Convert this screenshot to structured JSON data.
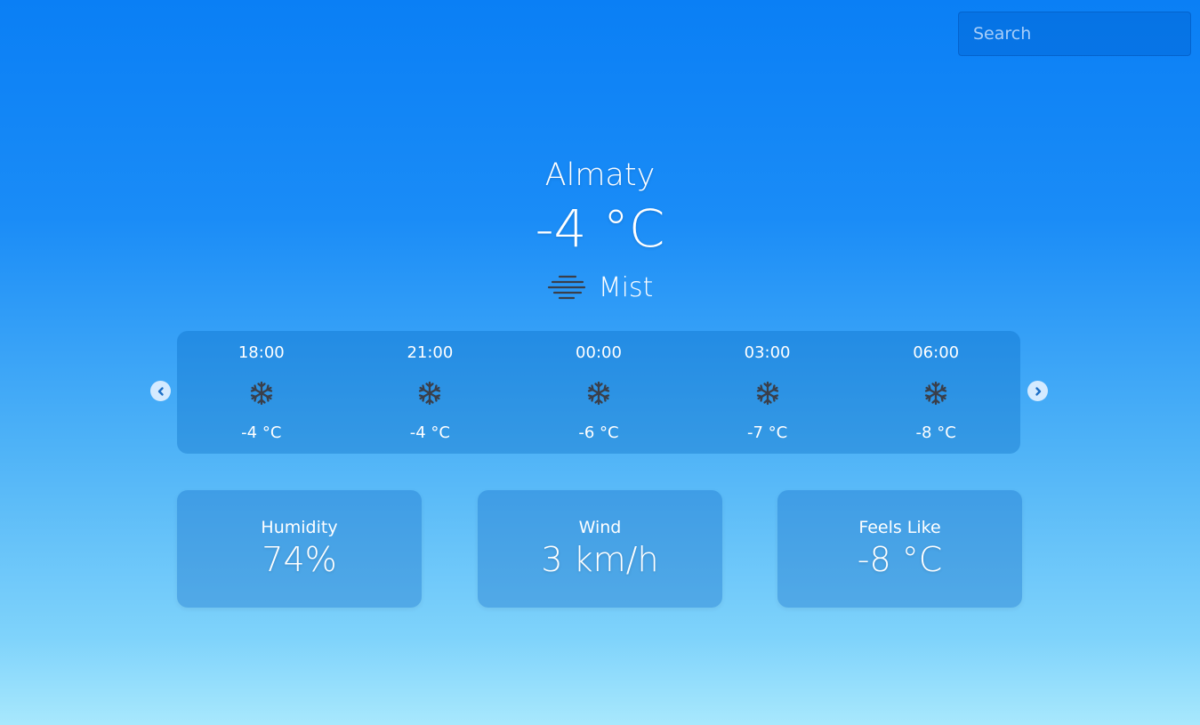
{
  "search": {
    "placeholder": "Search"
  },
  "current": {
    "city": "Almaty",
    "temperature": "-4 °C",
    "condition": "Mist",
    "condition_icon": "mist-icon"
  },
  "forecast": [
    {
      "time": "18:00",
      "icon": "snowflake-icon",
      "temp": "-4 °C"
    },
    {
      "time": "21:00",
      "icon": "snowflake-icon",
      "temp": "-4 °C"
    },
    {
      "time": "00:00",
      "icon": "snowflake-icon",
      "temp": "-6 °C"
    },
    {
      "time": "03:00",
      "icon": "snowflake-icon",
      "temp": "-7 °C"
    },
    {
      "time": "06:00",
      "icon": "snowflake-icon",
      "temp": "-8 °C"
    }
  ],
  "stats": {
    "humidity": {
      "label": "Humidity",
      "value": "74%"
    },
    "wind": {
      "label": "Wind",
      "value": "3 km/h"
    },
    "feels_like": {
      "label": "Feels Like",
      "value": "-8 °C"
    }
  },
  "colors": {
    "background_top": "#0a7ff5",
    "background_bottom": "#a8e8fd",
    "text": "#ffffff",
    "icon": "#3a3f4a"
  }
}
